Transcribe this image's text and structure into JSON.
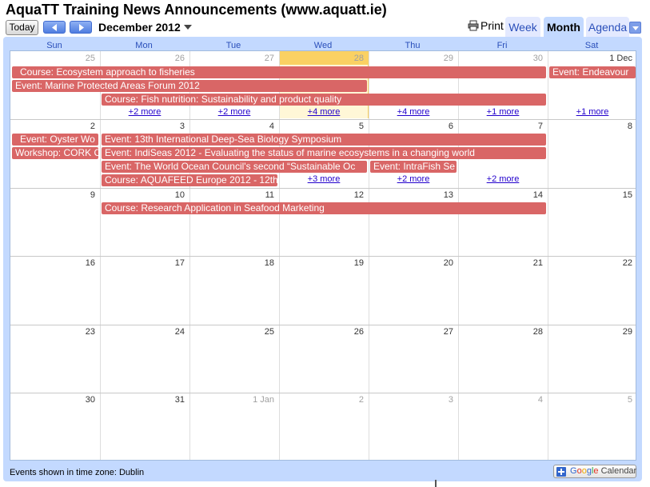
{
  "header": {
    "title": "AquaTT Training News Announcements (www.aquatt.ie)",
    "today_label": "Today",
    "date_range": "December 2012",
    "print_label": "Print",
    "tabs": {
      "week": "Week",
      "month": "Month",
      "agenda": "Agenda"
    },
    "active_tab": "Month"
  },
  "calendar": {
    "weekdays": [
      "Sun",
      "Mon",
      "Tue",
      "Wed",
      "Thu",
      "Fri",
      "Sat"
    ],
    "weeks": [
      [
        "25",
        "26",
        "27",
        "28",
        "29",
        "30",
        "1 Dec"
      ],
      [
        "2",
        "3",
        "4",
        "5",
        "6",
        "7",
        "8"
      ],
      [
        "9",
        "10",
        "11",
        "12",
        "13",
        "14",
        "15"
      ],
      [
        "16",
        "17",
        "18",
        "19",
        "20",
        "21",
        "22"
      ],
      [
        "23",
        "24",
        "25",
        "26",
        "27",
        "28",
        "29"
      ],
      [
        "30",
        "31",
        "1 Jan",
        "2",
        "3",
        "4",
        "5"
      ]
    ],
    "today_date": "28",
    "events": [
      "Course: Ecosystem approach to fisheries",
      "Event: Endeavour",
      "Event: Marine Protected Areas Forum 2012",
      "Course: Fish nutrition: Sustainability and product quality",
      "Event: Oyster Wo",
      "Event: 13th International Deep-Sea Biology Symposium",
      "Workshop: CORK C",
      "Event: IndiSeas 2012 - Evaluating the status of marine ecosystems in a changing world",
      "Event: The World Ocean Council's second “Sustainable Oc",
      "Event: IntraFish Se",
      "Course: AQUAFEED Europe 2012 - 12th",
      "Course: Research Application in Seafood Marketing"
    ],
    "more_links": {
      "w1": [
        "+2 more",
        "+2 more",
        "+4 more",
        "+4 more",
        "+1 more",
        "+1 more"
      ],
      "w2": [
        "+3 more",
        "+2 more",
        "+2 more"
      ]
    }
  },
  "footer": {
    "timezone_text": "Events shown in time zone: Dublin",
    "gcal_letters": [
      "G",
      "o",
      "o",
      "g",
      "l",
      "e"
    ],
    "gcal_word": "Calendar"
  },
  "colors": {
    "event": "#d96666",
    "today": "#fad163",
    "accent": "#c3d9ff",
    "link": "#2222cc"
  }
}
